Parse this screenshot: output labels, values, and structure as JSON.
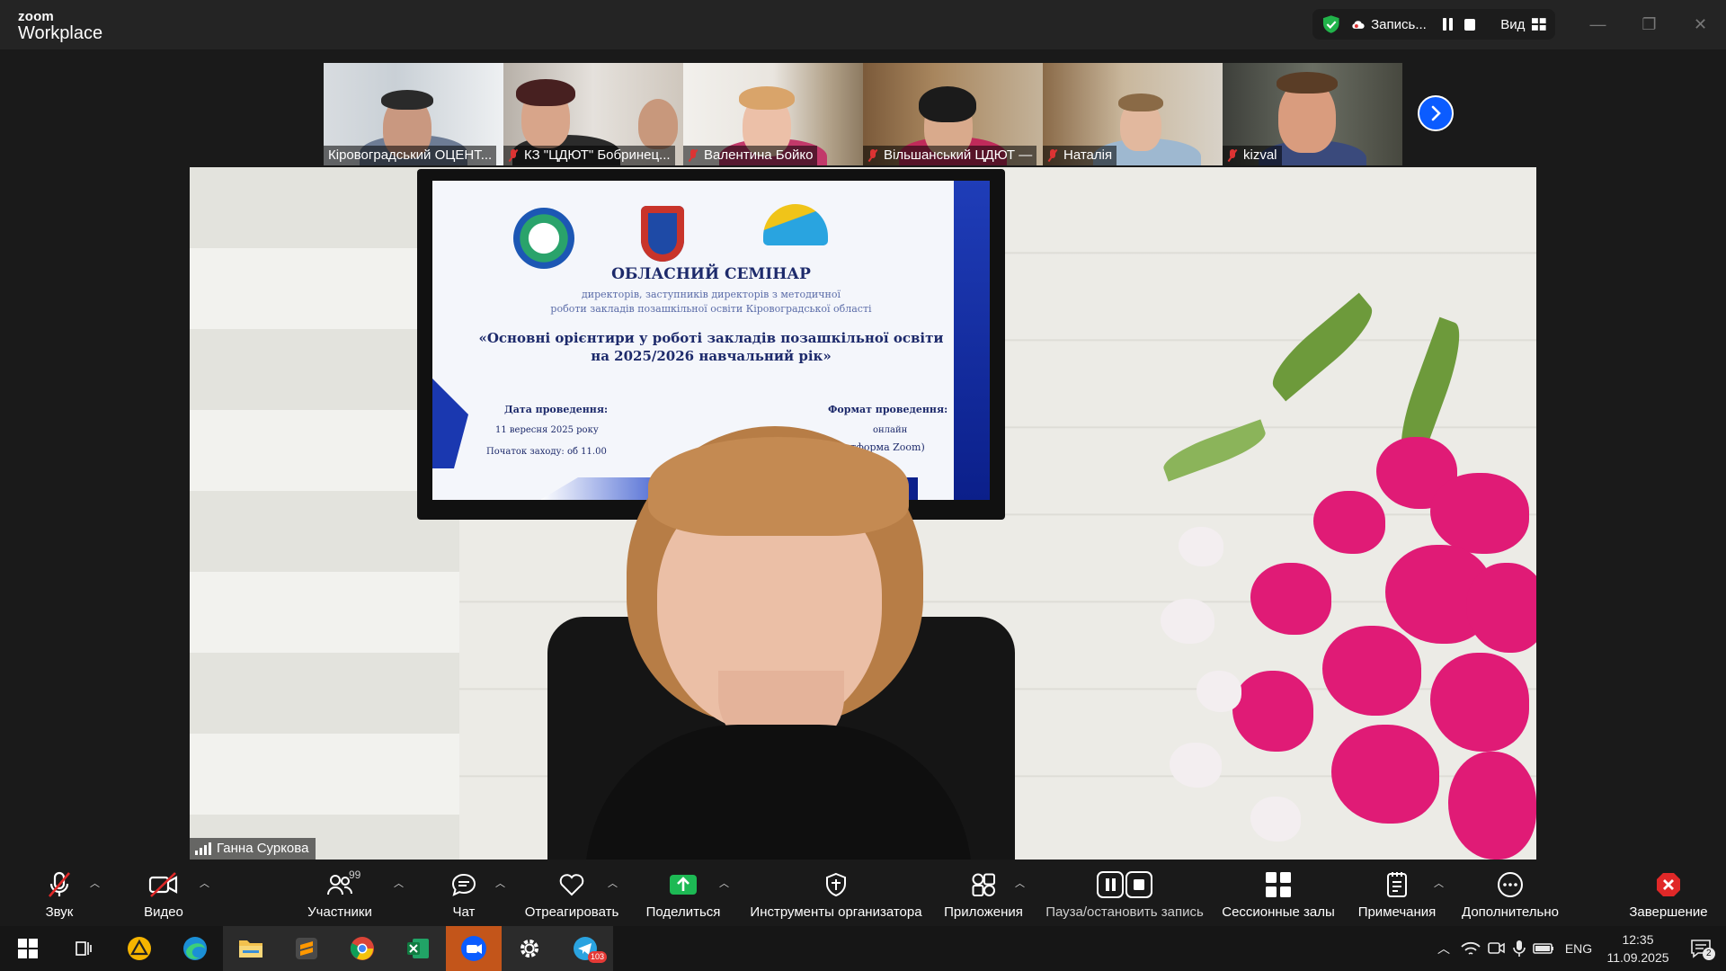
{
  "app": {
    "brand_small": "zoom",
    "brand_large": "Workplace"
  },
  "recording": {
    "label": "Запись...",
    "view_label": "Вид"
  },
  "window_controls": {
    "minimize": "—",
    "restore": "❐",
    "close": "✕"
  },
  "thumbnails": [
    {
      "name": "Кіровоградський ОЦЕНТ...",
      "muted": false
    },
    {
      "name": "КЗ \"ЦДЮТ\" Бобринец...",
      "muted": true
    },
    {
      "name": "Валентина Бойко",
      "muted": true
    },
    {
      "name": "Вільшанський ЦДЮТ —",
      "muted": true
    },
    {
      "name": "Наталія",
      "muted": true
    },
    {
      "name": "kizval",
      "muted": true
    }
  ],
  "slide": {
    "title": "ОБЛАСНИЙ СЕМІНАР",
    "subtitle_1": "директорів, заступників директорів з методичної",
    "subtitle_2": "роботи закладів позашкільної освіти Кіровоградської області",
    "theme_1": "«Основні орієнтири у роботі закладів позашкільної освіти",
    "theme_2": "на 2025/2026 навчальний рік»",
    "date_label": "Дата проведення:",
    "date_value": "11 вересня 2025 року",
    "start_label": "Початок заходу: об 11.00",
    "format_label": "Формат проведення:",
    "format_value": "онлайн",
    "platform": "(платформа Zoom)"
  },
  "speaker": {
    "name": "Ганна Суркова"
  },
  "toolbar": {
    "audio": "Звук",
    "video": "Видео",
    "participants": "Участники",
    "participants_count": "99",
    "chat": "Чат",
    "react": "Отреагировать",
    "share": "Поделиться",
    "host_tools": "Инструменты организатора",
    "apps": "Приложения",
    "pause_record": "Пауза/остановить запись",
    "breakout": "Сессионные залы",
    "notes": "Примечания",
    "more": "Дополнительно",
    "end": "Завершение"
  },
  "taskbar": {
    "telegram_badge": "103",
    "language": "ENG",
    "time": "12:35",
    "date": "11.09.2025",
    "notifications": "2"
  },
  "colors": {
    "accent": "#0b5cff",
    "end_red": "#e02828",
    "share_green": "#1db954",
    "zoom_taskbar": "#c3551a"
  }
}
